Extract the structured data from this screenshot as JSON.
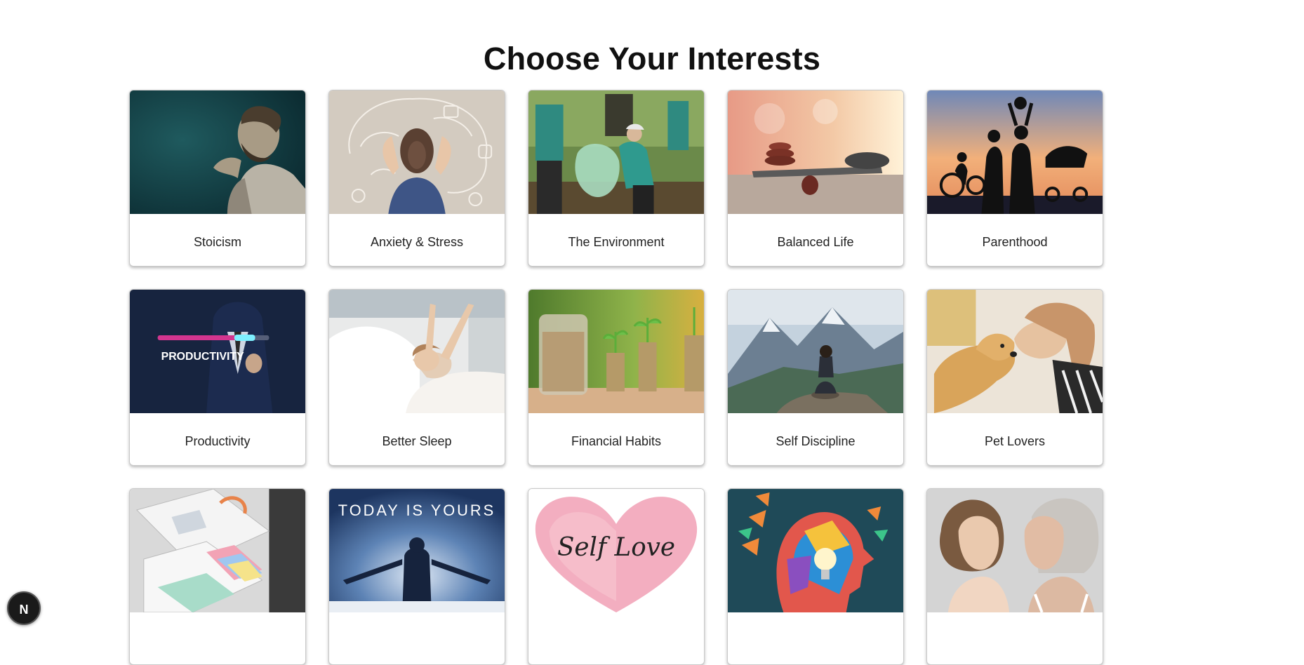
{
  "page": {
    "title": "Choose Your Interests"
  },
  "interests": [
    {
      "label": "Stoicism",
      "image": "stoic-statue-image"
    },
    {
      "label": "Anxiety & Stress",
      "image": "stressed-woman-brain-image"
    },
    {
      "label": "The Environment",
      "image": "volunteers-cleanup-image"
    },
    {
      "label": "Balanced Life",
      "image": "balanced-stones-image"
    },
    {
      "label": "Parenthood",
      "image": "family-silhouette-image"
    },
    {
      "label": "Productivity",
      "image": "productivity-bar-image",
      "image_text": "PRODUCTIVITY"
    },
    {
      "label": "Better Sleep",
      "image": "woman-waking-bed-image"
    },
    {
      "label": "Financial Habits",
      "image": "coin-stacks-image"
    },
    {
      "label": "Self Discipline",
      "image": "meditating-mountain-image"
    },
    {
      "label": "Pet Lovers",
      "image": "girl-dog-image"
    },
    {
      "label": "",
      "image": "organized-drawer-image"
    },
    {
      "label": "",
      "image": "today-is-yours-image",
      "image_text": "TODAY IS YOURS"
    },
    {
      "label": "",
      "image": "self-love-heart-image",
      "image_text": "Self Love"
    },
    {
      "label": "",
      "image": "colorful-head-bulb-image"
    },
    {
      "label": "",
      "image": "young-old-woman-image"
    }
  ],
  "badge": {
    "letter": "N",
    "icon": "nextjs-logo-icon"
  }
}
